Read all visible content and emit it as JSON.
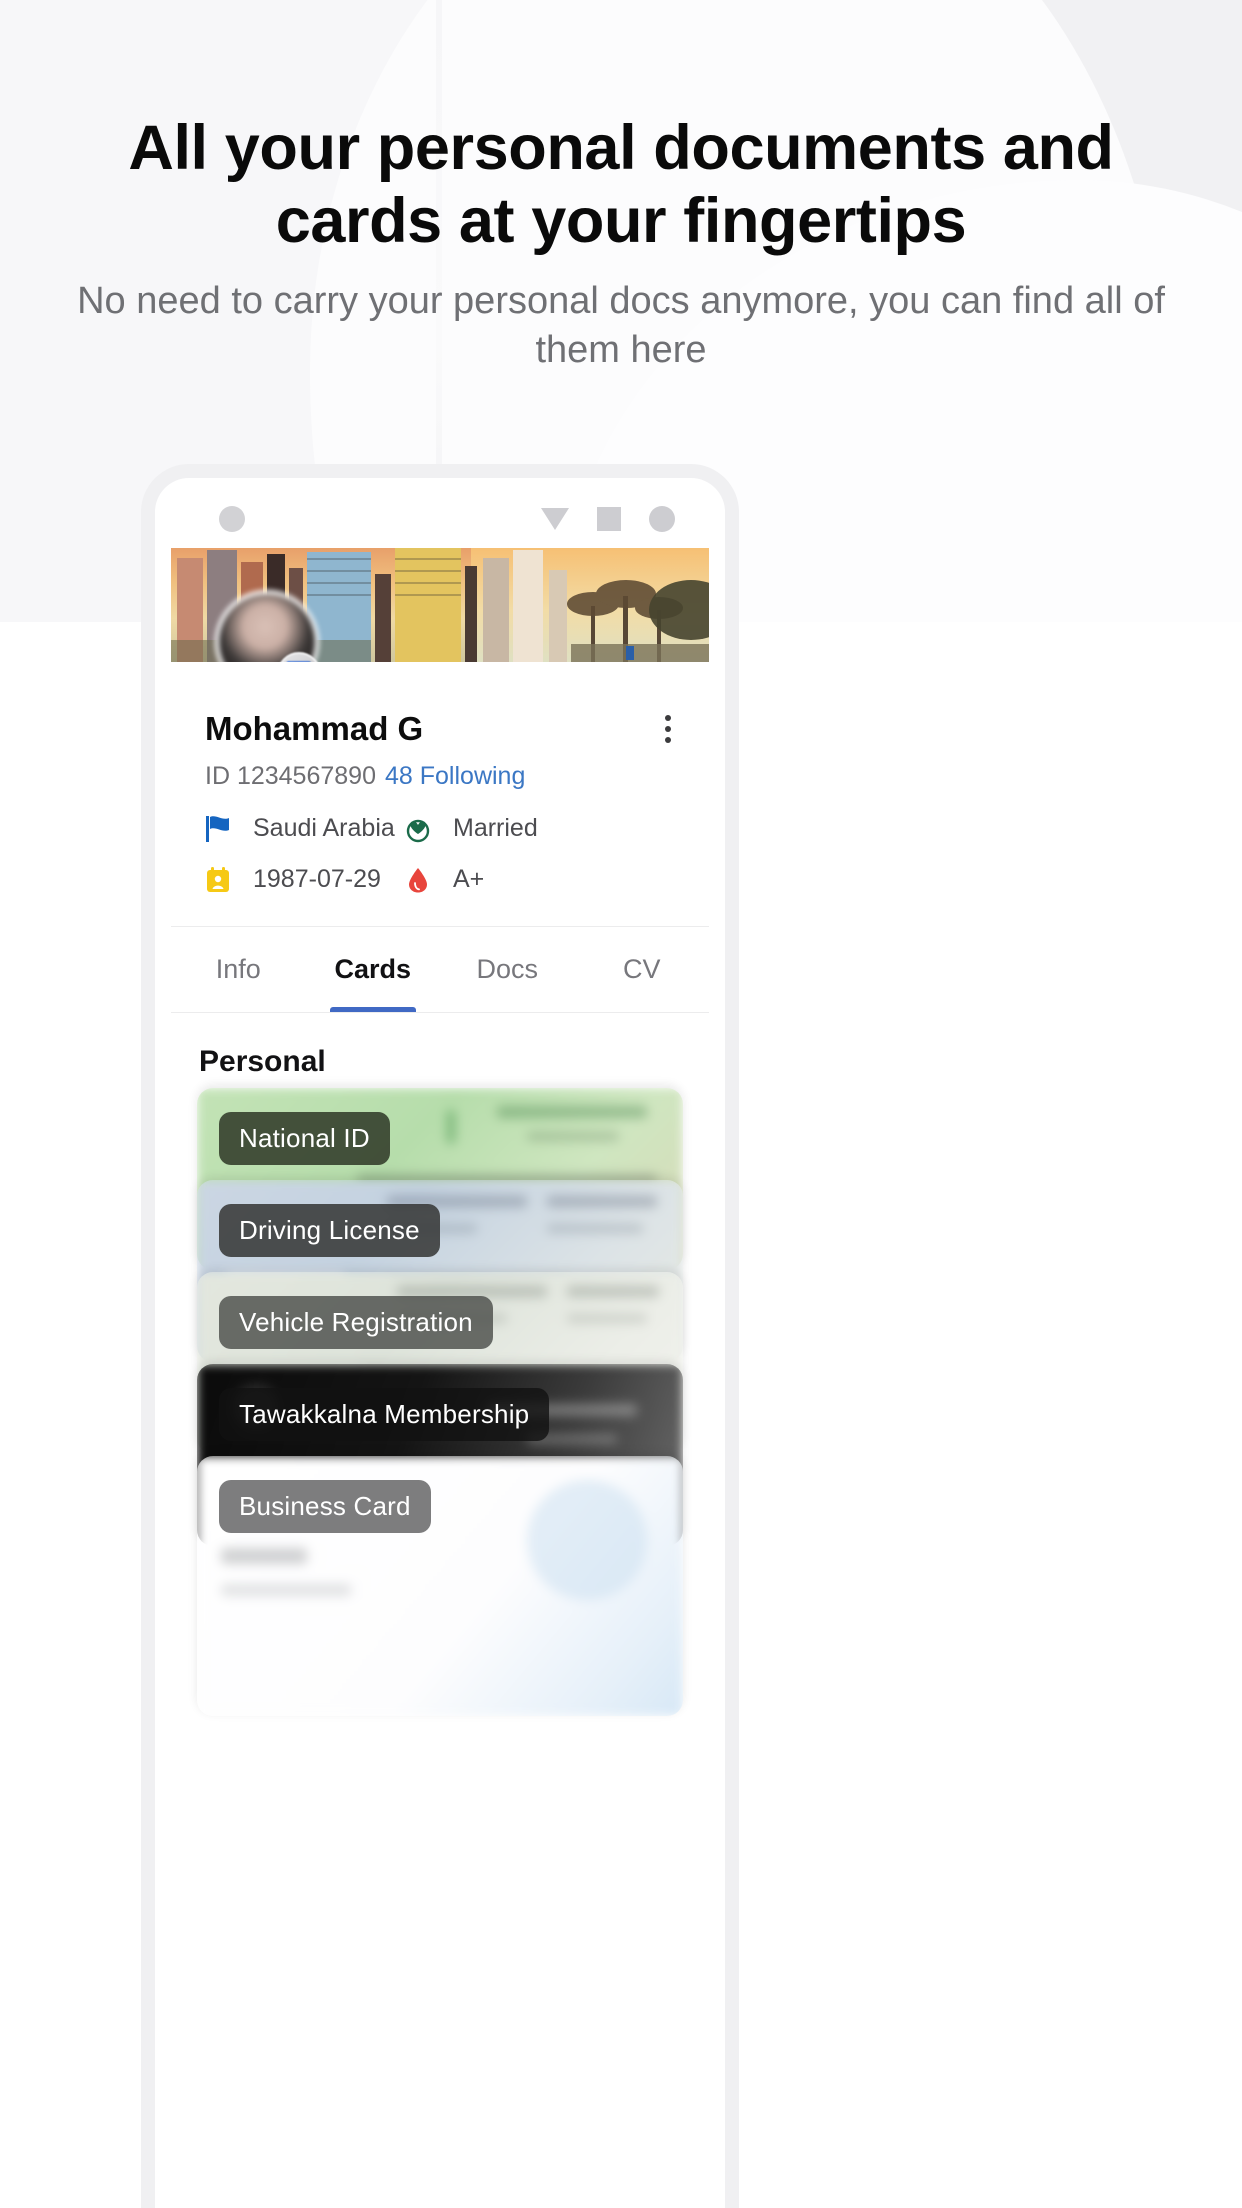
{
  "promo": {
    "headline": "All your personal documents and cards at your fingertips",
    "subtitle": "No need to carry your personal docs anymore, you can find all of them here"
  },
  "phone": {
    "status_bar": {
      "left_dot": "camera-dot",
      "nav_back": "back-triangle-icon",
      "nav_home": "home-square-icon",
      "nav_recent": "recents-circle-icon"
    },
    "profile": {
      "name": "Mohammad G",
      "id_label": "ID 1234567890",
      "following": "48 Following",
      "menu_icon": "kebab-menu-icon",
      "avatar_badge_icon": "verified-badge-icon",
      "meta": [
        {
          "icon": "flag-icon",
          "label": "Saudi Arabia",
          "color": "#1565c0"
        },
        {
          "icon": "heart-icon",
          "label": "Married",
          "color": "#1b6b4a"
        },
        {
          "icon": "calendar-icon",
          "label": "1987-07-29",
          "color": "#f6c915"
        },
        {
          "icon": "blood-drop-icon",
          "label": "A+",
          "color": "#e8453c"
        }
      ]
    },
    "tabs": [
      {
        "label": "Info",
        "active": false
      },
      {
        "label": "Cards",
        "active": true
      },
      {
        "label": "Docs",
        "active": false
      },
      {
        "label": "CV",
        "active": false
      }
    ],
    "section_title": "Personal",
    "cards": [
      {
        "label": "National ID",
        "bg": "#bfe0b4",
        "pill_bg": "rgba(46,56,38,0.86)"
      },
      {
        "label": "Driving License",
        "bg": "#ccd5e1",
        "pill_bg": "rgba(52,54,52,0.86)"
      },
      {
        "label": "Vehicle Registration",
        "bg": "#dfe3db",
        "pill_bg": "rgba(76,78,74,0.82)"
      },
      {
        "label": "Tawakkalna Membership",
        "bg": "#1b1b1b",
        "pill_bg": "rgba(18,18,18,0.80)"
      },
      {
        "label": "Business Card",
        "bg": "#fdfdfd",
        "pill_bg": "rgba(96,96,98,0.82)"
      }
    ]
  },
  "colors": {
    "hero_bg": "#f1f1f3",
    "accent_blue": "#3b77c4",
    "tab_indicator": "#4069c4",
    "headline": "#0a0a0a",
    "subtitle": "#6f7074"
  }
}
